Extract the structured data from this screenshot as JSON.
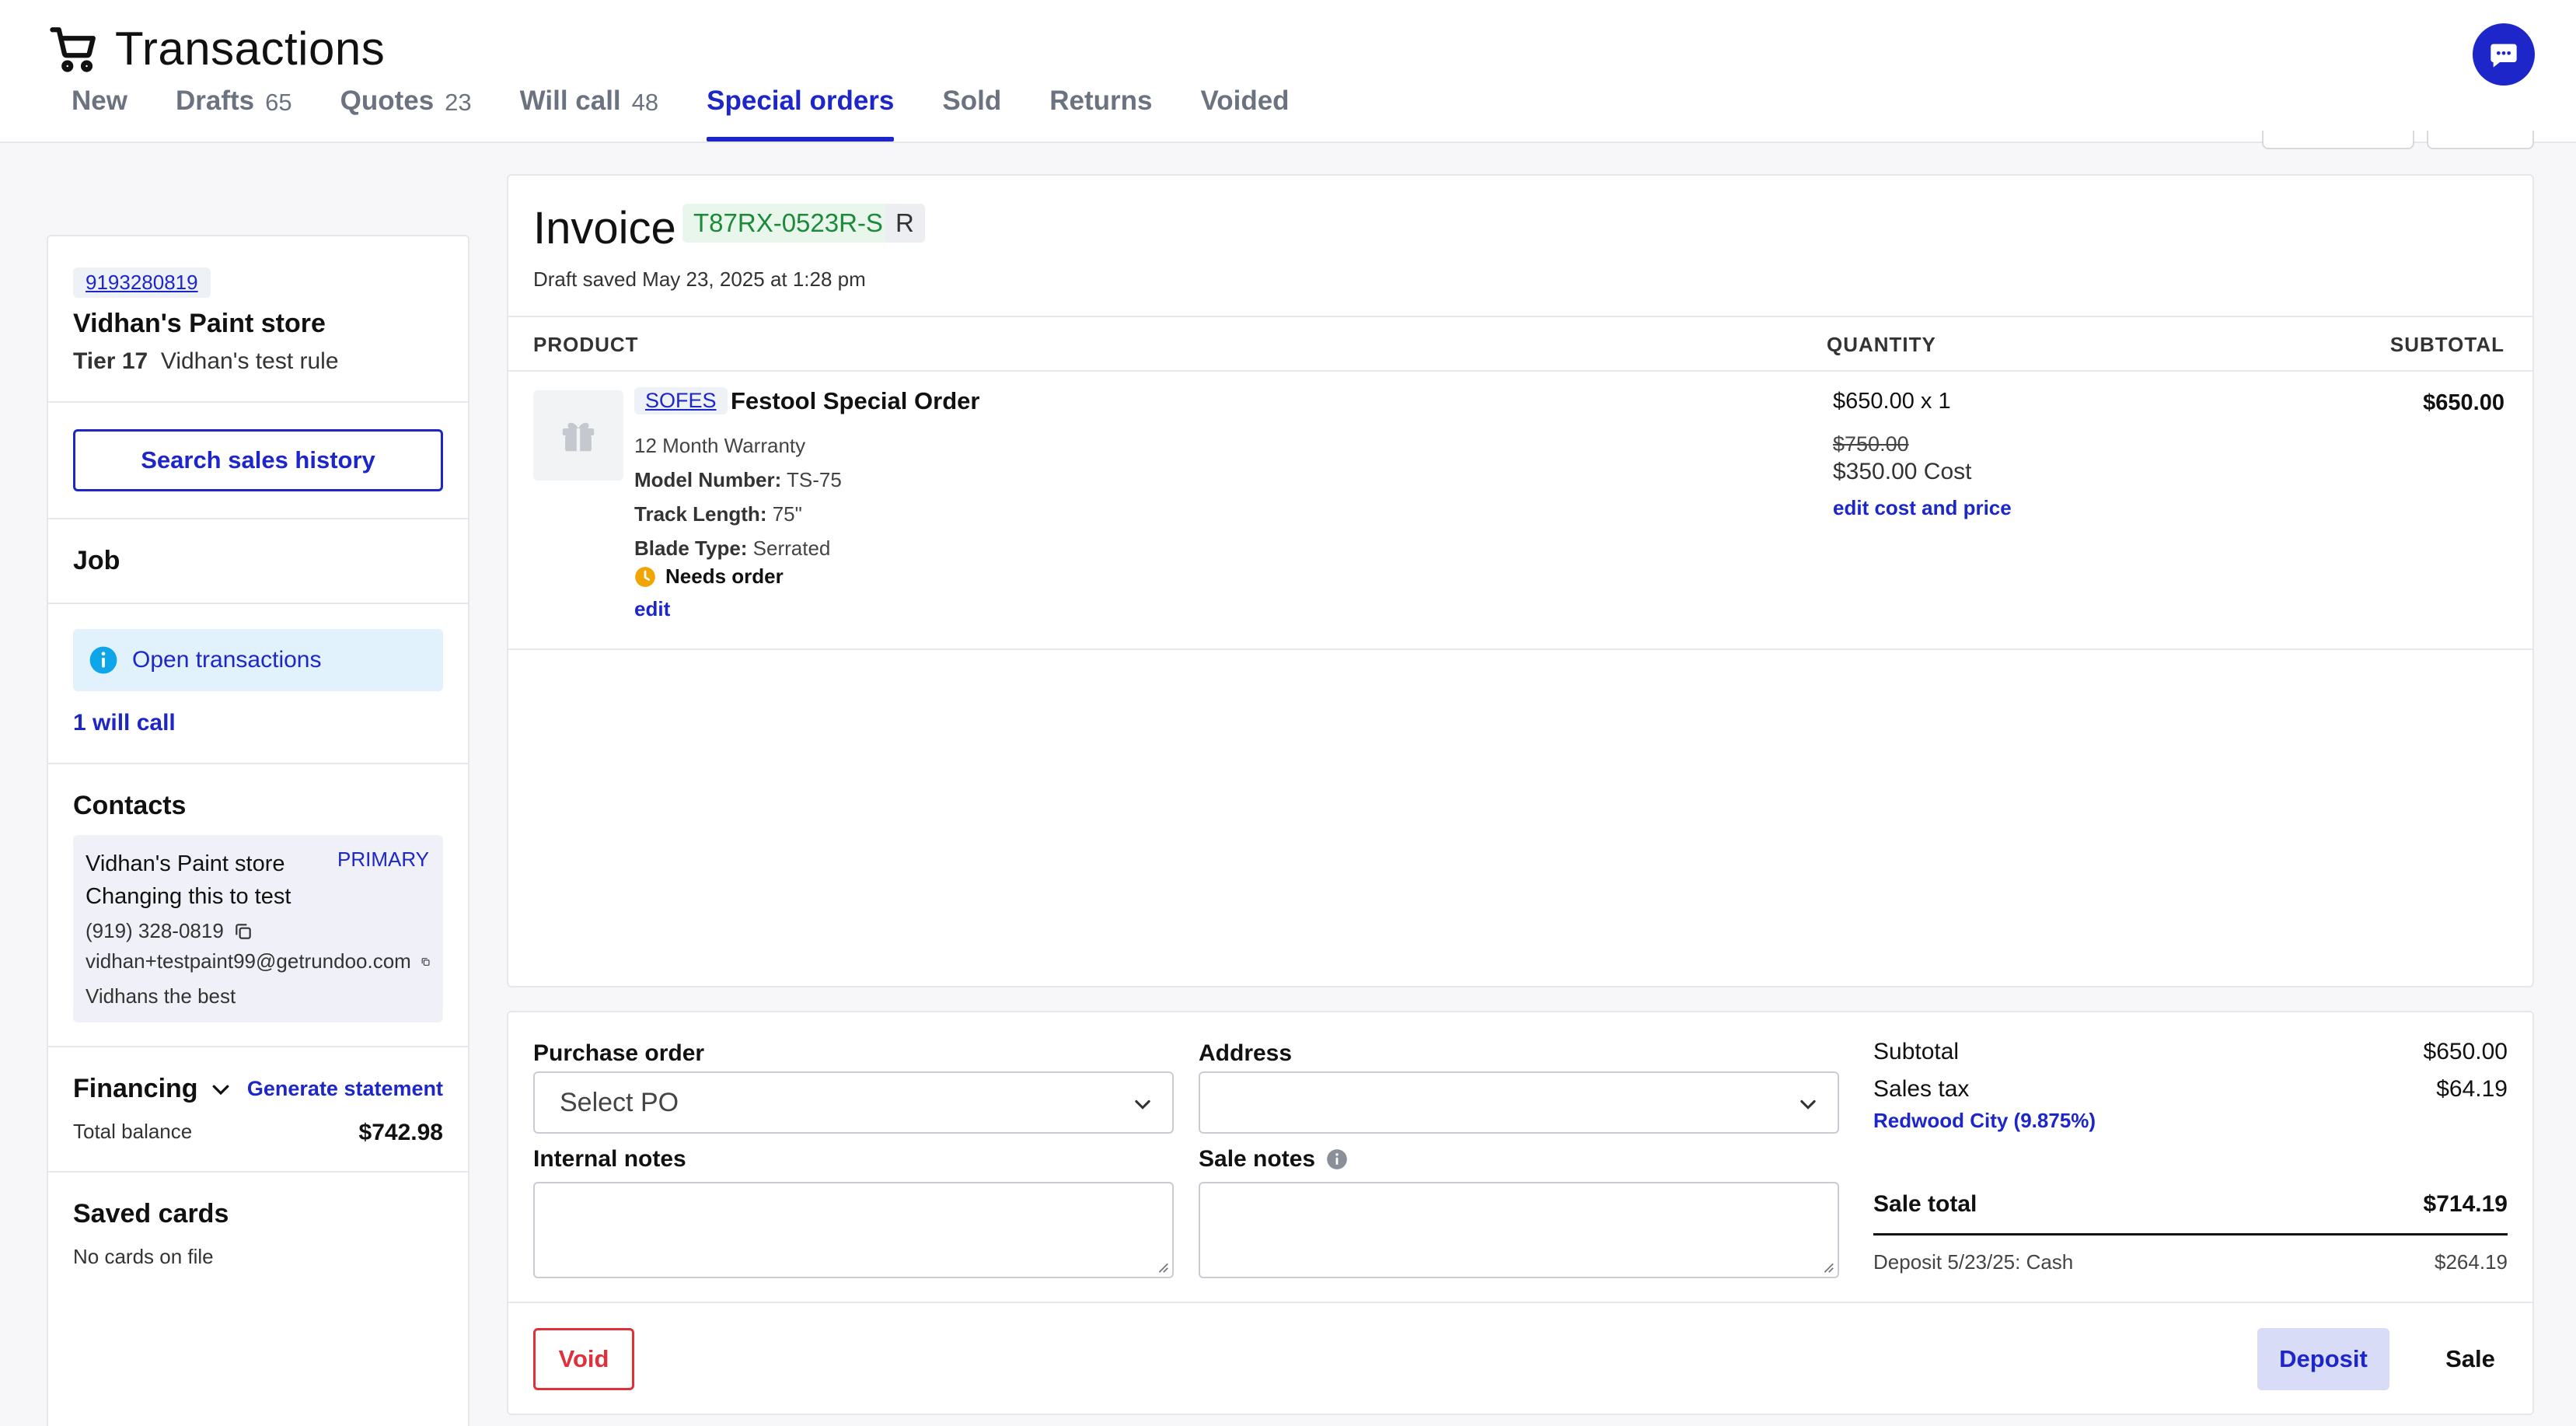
{
  "header": {
    "title": "Transactions",
    "tabs": [
      {
        "label": "New",
        "count": ""
      },
      {
        "label": "Drafts",
        "count": "65"
      },
      {
        "label": "Quotes",
        "count": "23"
      },
      {
        "label": "Will call",
        "count": "48"
      },
      {
        "label": "Special orders",
        "count": ""
      },
      {
        "label": "Sold",
        "count": ""
      },
      {
        "label": "Returns",
        "count": ""
      },
      {
        "label": "Voided",
        "count": ""
      }
    ],
    "active_tab": "Special orders"
  },
  "customer": {
    "phone": "9193280819",
    "name": "Vidhan's Paint store",
    "tier_label": "Tier 17",
    "tier_rule": "Vidhan's test rule"
  },
  "sidebar": {
    "search_history_label": "Search sales history",
    "job_title": "Job",
    "open_transactions_label": "Open transactions",
    "will_call_link": "1 will call",
    "contacts_title": "Contacts",
    "contact": {
      "line1": "Vidhan's Paint store",
      "line2": "Changing this to test",
      "primary_tag": "PRIMARY",
      "phone": "(919) 328-0819",
      "email": "vidhan+testpaint99@getrundoo.com",
      "note": "Vidhans the best"
    },
    "financing": {
      "title": "Financing",
      "generate_label": "Generate statement",
      "balance_label": "Total balance",
      "balance_value": "$742.98"
    },
    "saved_cards": {
      "title": "Saved cards",
      "empty_text": "No cards on file"
    }
  },
  "invoice": {
    "title": "Invoice",
    "id": "T87RX-0523R-S",
    "type_badge": "R",
    "saved_text": "Draft saved May 23, 2025 at 1:28 pm",
    "columns": {
      "product": "PRODUCT",
      "quantity": "QUANTITY",
      "subtotal": "SUBTOTAL"
    },
    "item": {
      "sku": "SOFES",
      "name": "Festool Special Order",
      "warranty": "12 Month Warranty",
      "attrs": [
        {
          "label": "Model Number:",
          "value": "TS-75"
        },
        {
          "label": "Track Length:",
          "value": "75\""
        },
        {
          "label": "Blade Type:",
          "value": "Serrated"
        }
      ],
      "status": "Needs order",
      "edit_label": "edit",
      "qty_price": "$650.00 x 1",
      "original_price": "$750.00",
      "cost": "$350.00 Cost",
      "edit_cost_label": "edit cost and price",
      "subtotal": "$650.00"
    }
  },
  "footer": {
    "purchase_order_label": "Purchase order",
    "purchase_order_placeholder": "Select PO",
    "address_label": "Address",
    "address_value": "",
    "internal_notes_label": "Internal notes",
    "sale_notes_label": "Sale notes",
    "summary": {
      "subtotal_label": "Subtotal",
      "subtotal_value": "$650.00",
      "tax_label": "Sales tax",
      "tax_value": "$64.19",
      "tax_region": "Redwood City (9.875%)",
      "total_label": "Sale total",
      "total_value": "$714.19",
      "deposit_label": "Deposit 5/23/25: Cash",
      "deposit_value": "$264.19"
    },
    "void_label": "Void",
    "deposit_label": "Deposit",
    "sale_label": "Sale"
  },
  "colors": {
    "accent": "#1d26c9",
    "danger": "#e0313b",
    "success_badge_text": "#1b8a3a",
    "warning": "#f0a500"
  }
}
